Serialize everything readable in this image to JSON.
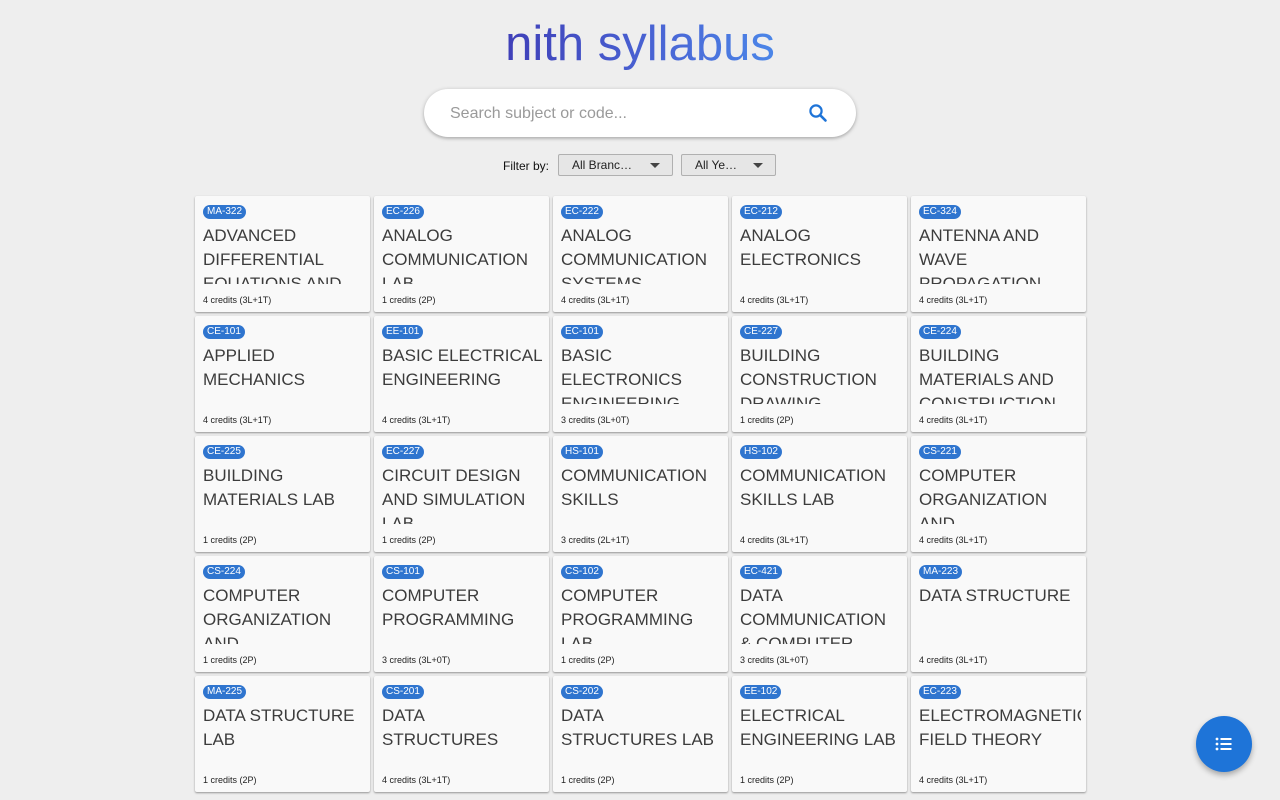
{
  "app_title": "nith syllabus",
  "search": {
    "placeholder": "Search subject or code...",
    "value": ""
  },
  "filter": {
    "label": "Filter by:",
    "branch_selected": "All Branches",
    "year_selected": "All Years"
  },
  "subjects": [
    {
      "code": "MA-322",
      "name": "Advanced Differential Equations and",
      "credits": "4 credits",
      "split": "(3L+1T)"
    },
    {
      "code": "EC-226",
      "name": "Analog Communication Lab",
      "credits": "1 credits",
      "split": "(2P)"
    },
    {
      "code": "EC-222",
      "name": "Analog Communication Systems",
      "credits": "4 credits",
      "split": "(3L+1T)"
    },
    {
      "code": "EC-212",
      "name": "Analog Electronics",
      "credits": "4 credits",
      "split": "(3L+1T)"
    },
    {
      "code": "EC-324",
      "name": "Antenna and Wave Propagation",
      "credits": "4 credits",
      "split": "(3L+1T)"
    },
    {
      "code": "CE-101",
      "name": "Applied Mechanics",
      "credits": "4 credits",
      "split": "(3L+1T)"
    },
    {
      "code": "EE-101",
      "name": "Basic Electrical Engineering",
      "credits": "4 credits",
      "split": "(3L+1T)"
    },
    {
      "code": "EC-101",
      "name": "Basic Electronics Engineering",
      "credits": "3 credits",
      "split": "(3L+0T)"
    },
    {
      "code": "CE-227",
      "name": "Building Construction Drawing",
      "credits": "1 credits",
      "split": "(2P)"
    },
    {
      "code": "CE-224",
      "name": "Building Materials and Construction",
      "credits": "4 credits",
      "split": "(3L+1T)"
    },
    {
      "code": "CE-225",
      "name": "Building Materials Lab",
      "credits": "1 credits",
      "split": "(2P)"
    },
    {
      "code": "EC-227",
      "name": "Circuit Design and Simulation Lab",
      "credits": "1 credits",
      "split": "(2P)"
    },
    {
      "code": "HS-101",
      "name": "Communication Skills",
      "credits": "3 credits",
      "split": "(2L+1T)"
    },
    {
      "code": "HS-102",
      "name": "Communication Skills Lab",
      "credits": "4 credits",
      "split": "(3L+1T)"
    },
    {
      "code": "CS-221",
      "name": "Computer Organization and",
      "credits": "4 credits",
      "split": "(3L+1T)"
    },
    {
      "code": "CS-224",
      "name": "Computer Organization and",
      "credits": "1 credits",
      "split": "(2P)"
    },
    {
      "code": "CS-101",
      "name": "Computer Programming",
      "credits": "3 credits",
      "split": "(3L+0T)"
    },
    {
      "code": "CS-102",
      "name": "Computer Programming Lab",
      "credits": "1 credits",
      "split": "(2P)"
    },
    {
      "code": "EC-421",
      "name": "Data Communication & Computer",
      "credits": "3 credits",
      "split": "(3L+0T)"
    },
    {
      "code": "MA-223",
      "name": "Data Structure",
      "credits": "4 credits",
      "split": "(3L+1T)"
    },
    {
      "code": "MA-225",
      "name": "Data Structure Lab",
      "credits": "1 credits",
      "split": "(2P)"
    },
    {
      "code": "CS-201",
      "name": "Data Structures",
      "credits": "4 credits",
      "split": "(3L+1T)"
    },
    {
      "code": "CS-202",
      "name": "Data Structures Lab",
      "credits": "1 credits",
      "split": "(2P)"
    },
    {
      "code": "EE-102",
      "name": "Electrical Engineering Lab",
      "credits": "1 credits",
      "split": "(2P)"
    },
    {
      "code": "EC-223",
      "name": "Electromagnetic Field Theory",
      "credits": "4 credits",
      "split": "(3L+1T)"
    }
  ],
  "colors": {
    "accent": "#1e74d8",
    "badge": "#2f75cf",
    "background": "#eeeeee"
  },
  "icons": {
    "search": "search-icon",
    "fab": "list-icon"
  }
}
